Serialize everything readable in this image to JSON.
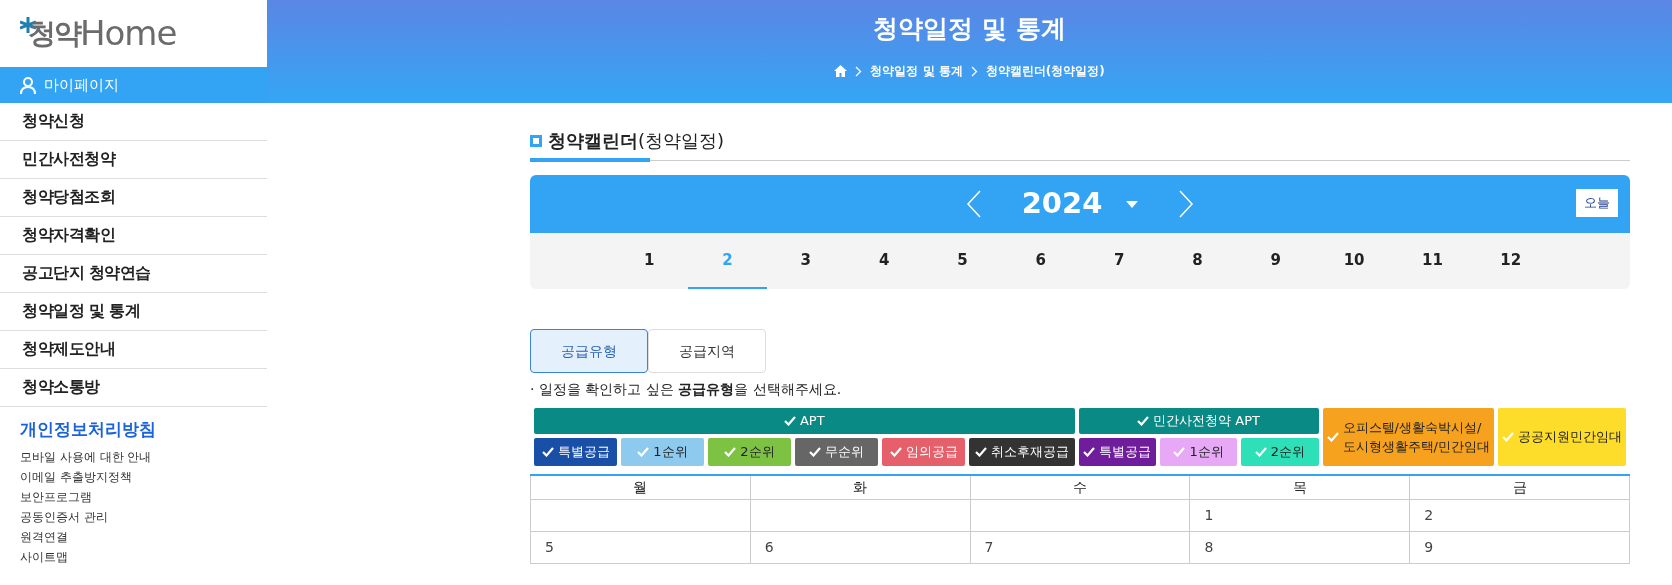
{
  "sidebar": {
    "logo": {
      "hangul": "청약",
      "latin": "Home"
    },
    "mypage": "마이페이지",
    "items": [
      "청약신청",
      "민간사전청약",
      "청약당첨조회",
      "청약자격확인",
      "공고단지 청약연습",
      "청약일정 및 통계",
      "청약제도안내",
      "청약소통방"
    ],
    "privacy": "개인정보처리방침",
    "links": [
      "모바일 사용에 대한 안내",
      "이메일 추출방지정책",
      "보안프로그램",
      "공동인증서 관리",
      "원격연결",
      "사이트맵"
    ]
  },
  "header": {
    "title": "청약일정 및 통계",
    "breadcrumb": [
      "청약일정 및 통계",
      "청약캘린더(청약일정)"
    ]
  },
  "section_title": {
    "main": "청약캘린더",
    "sub": "(청약일정)"
  },
  "calendar": {
    "year": "2024",
    "today_button": "오늘",
    "months": [
      {
        "label": "1",
        "selected": false
      },
      {
        "label": "2",
        "selected": true
      },
      {
        "label": "3",
        "selected": false
      },
      {
        "label": "4",
        "selected": false
      },
      {
        "label": "5",
        "selected": false
      },
      {
        "label": "6",
        "selected": false
      },
      {
        "label": "7",
        "selected": false
      },
      {
        "label": "8",
        "selected": false
      },
      {
        "label": "9",
        "selected": false
      },
      {
        "label": "10",
        "selected": false
      },
      {
        "label": "11",
        "selected": false
      },
      {
        "label": "12",
        "selected": false
      }
    ]
  },
  "tabs": [
    {
      "label": "공급유형",
      "selected": true
    },
    {
      "label": "공급지역",
      "selected": false
    }
  ],
  "note": "· 일정을 확인하고 싶은 **공급유형**을 선택해주세요.",
  "filters": [
    {
      "label": "APT",
      "color": "#0a8a84",
      "checked": true,
      "children": [
        {
          "label": "특별공급",
          "color": "#1a4fa8",
          "checked": true
        },
        {
          "label": "1순위",
          "color": "#8ec9ee",
          "checked": true
        },
        {
          "label": "2순위",
          "color": "#7dc242",
          "checked": true
        },
        {
          "label": "무순위",
          "color": "#666666",
          "checked": true
        },
        {
          "label": "임의공급",
          "color": "#e5606a",
          "checked": true
        },
        {
          "label": "취소후재공급",
          "color": "#333333",
          "checked": true
        }
      ]
    },
    {
      "label": "민간사전청약 APT",
      "color": "#0a8a84",
      "checked": true,
      "children": [
        {
          "label": "특별공급",
          "color": "#6f1d9b",
          "checked": true
        },
        {
          "label": "1순위",
          "color": "#e7a8f5",
          "checked": true
        },
        {
          "label": "2순위",
          "color": "#2ee0b8",
          "checked": true
        }
      ]
    },
    {
      "label": "오피스텔/생활숙박시설/\n도시형생활주택/민간임대",
      "color": "#f6a21e",
      "checked": true
    },
    {
      "label": "공공지원민간임대",
      "color": "#fddc2a",
      "checked": true
    }
  ],
  "table": {
    "columns": [
      "월",
      "화",
      "수",
      "목",
      "금"
    ],
    "rows": [
      [
        "",
        "",
        "",
        "1",
        "2"
      ],
      [
        "5",
        "6",
        "7",
        "8",
        "9"
      ]
    ]
  }
}
